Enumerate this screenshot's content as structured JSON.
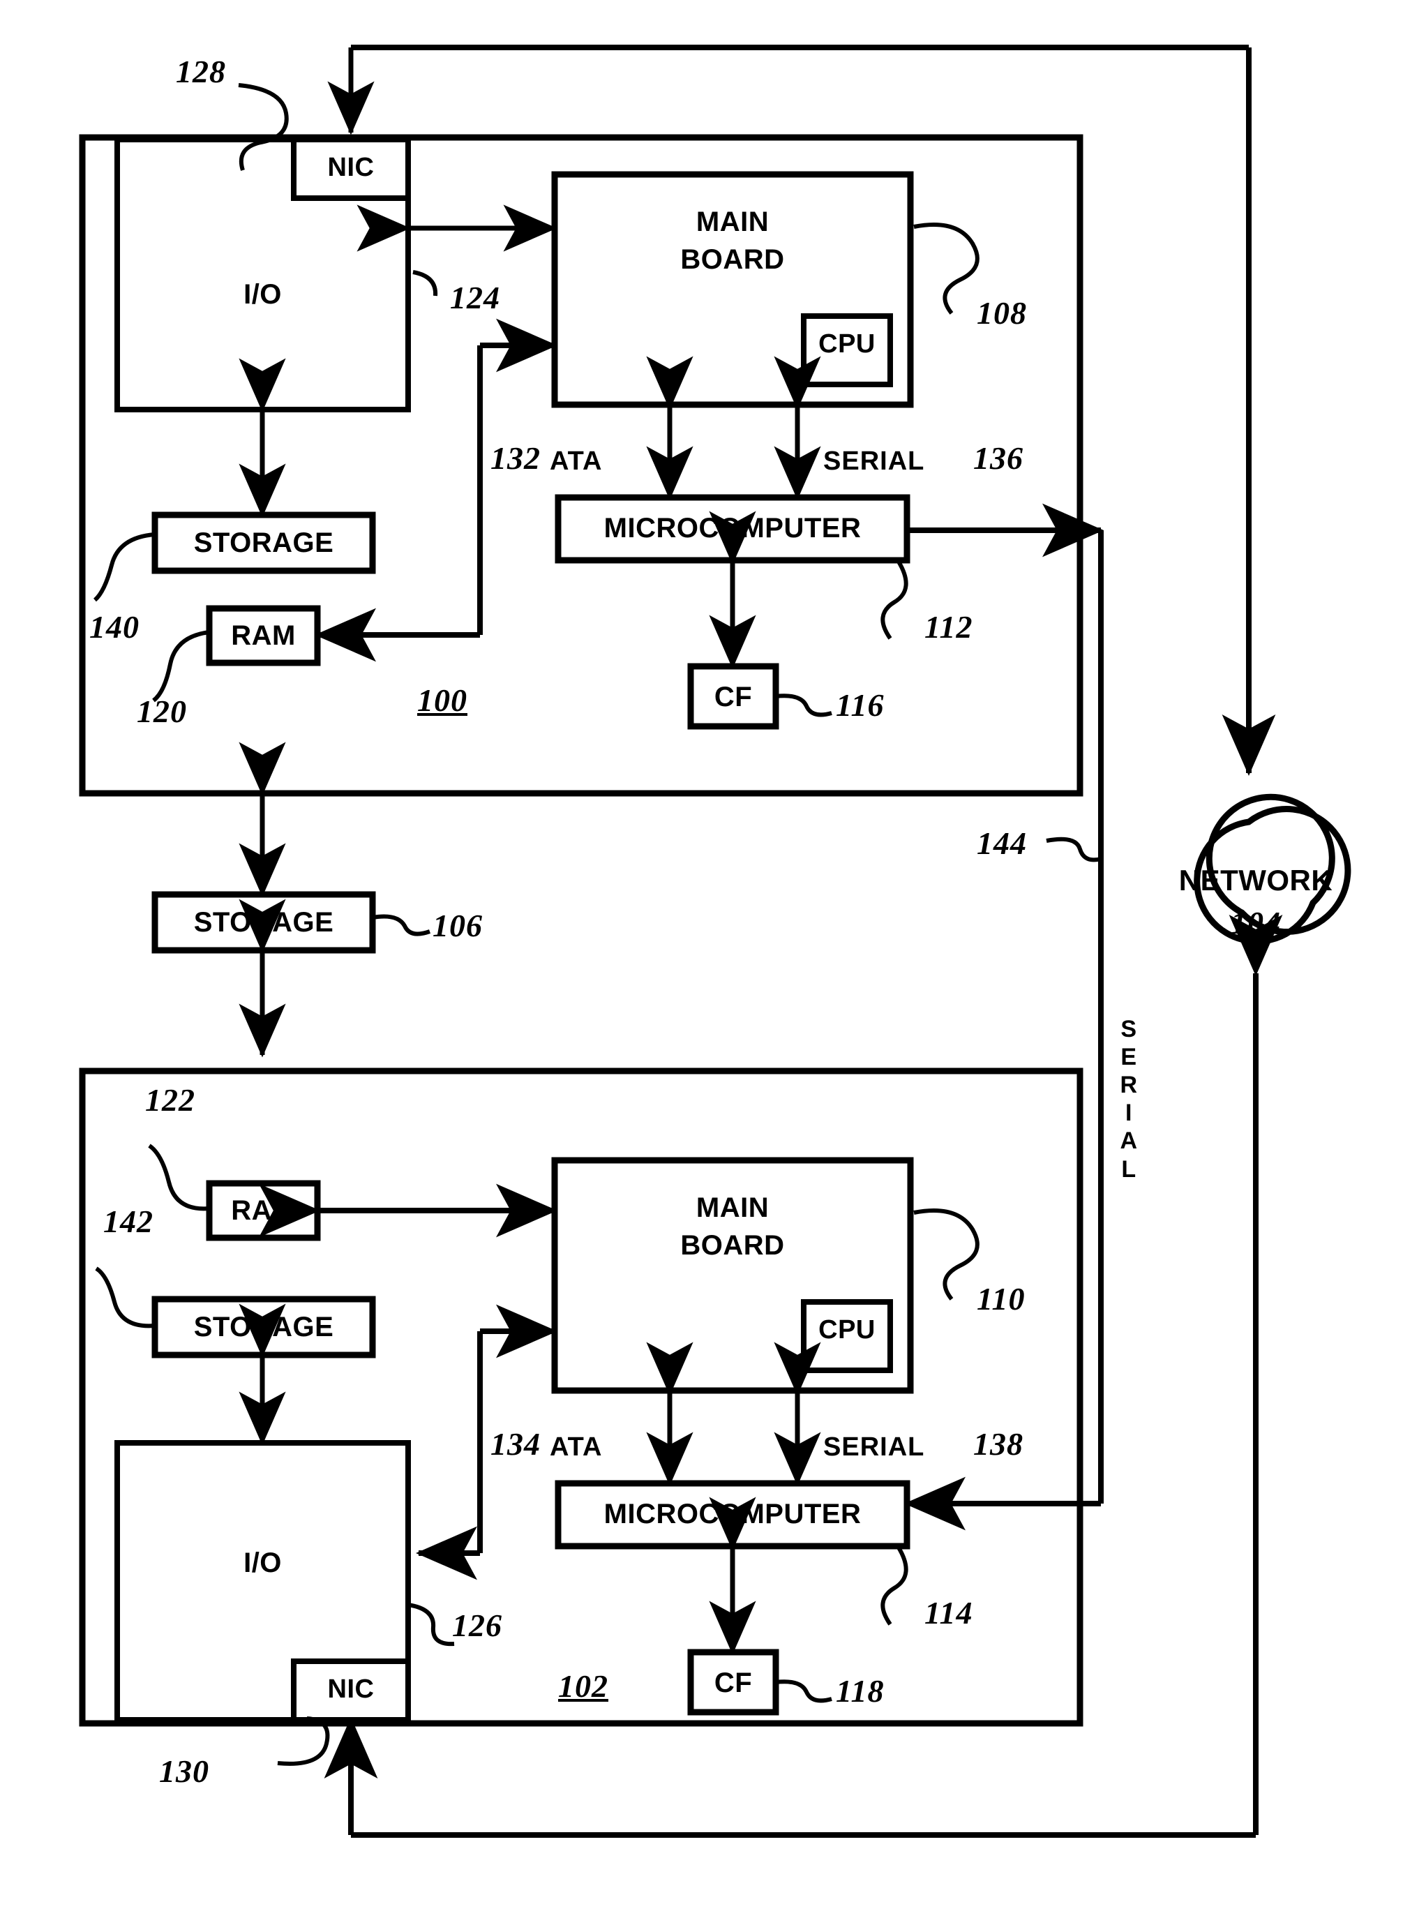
{
  "figure": {
    "type": "patent-block-diagram",
    "background": "#ffffff",
    "ink": "#000000"
  },
  "network": {
    "label": "NETWORK",
    "ref": "104"
  },
  "shared_storage": {
    "label": "STORAGE",
    "ref": "106"
  },
  "serial_trunk": {
    "ref": "144",
    "letters": [
      "S",
      "E",
      "R",
      "I",
      "A",
      "L"
    ],
    "label": "SERIAL"
  },
  "systems": [
    {
      "id": "top",
      "ref": "100",
      "io": {
        "label": "I/O"
      },
      "nic": {
        "label": "NIC",
        "ref": "128"
      },
      "nic_bus_ref": "124",
      "mainboard": {
        "label_line1": "MAIN",
        "label_line2": "BOARD",
        "ref": "108"
      },
      "cpu": {
        "label": "CPU"
      },
      "storage": {
        "label": "STORAGE",
        "ref": "140"
      },
      "ram": {
        "label": "RAM",
        "ref": "120"
      },
      "microcomputer": {
        "label": "MICROCOMPUTER",
        "ref": "112"
      },
      "cf": {
        "label": "CF",
        "ref": "116"
      },
      "ata_bus": {
        "label": "ATA",
        "ref": "132"
      },
      "serial_bus": {
        "label": "SERIAL",
        "ref": "136"
      }
    },
    {
      "id": "bottom",
      "ref": "102",
      "io": {
        "label": "I/O"
      },
      "nic": {
        "label": "NIC",
        "ref": "130"
      },
      "nic_bus_ref": "126",
      "mainboard": {
        "label_line1": "MAIN",
        "label_line2": "BOARD",
        "ref": "110"
      },
      "cpu": {
        "label": "CPU"
      },
      "storage": {
        "label": "STORAGE",
        "ref": "142"
      },
      "ram": {
        "label": "RAM",
        "ref": "122"
      },
      "microcomputer": {
        "label": "MICROCOMPUTER",
        "ref": "114"
      },
      "cf": {
        "label": "CF",
        "ref": "118"
      },
      "ata_bus": {
        "label": "ATA",
        "ref": "134"
      },
      "serial_bus": {
        "label": "SERIAL",
        "ref": "138"
      }
    }
  ]
}
